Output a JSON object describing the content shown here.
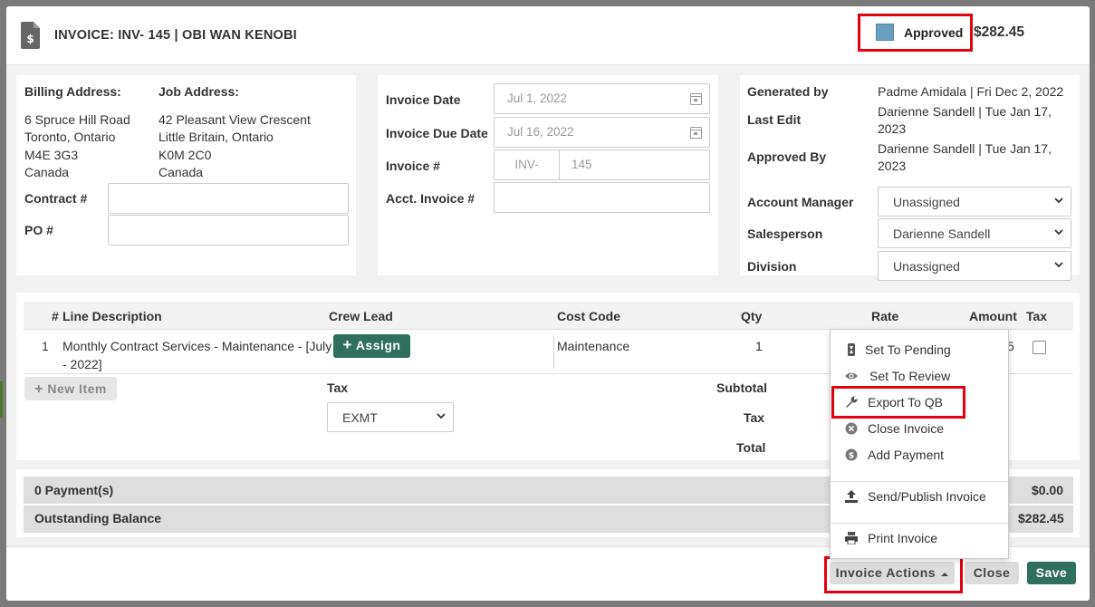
{
  "header": {
    "title": "INVOICE: INV- 145 | OBI WAN KENOBI",
    "status": "Approved",
    "status_color": "#6a9fbf",
    "total": "$282.45"
  },
  "billing": {
    "billing_label": "Billing Address:",
    "billing_lines": [
      "6 Spruce Hill Road",
      "Toronto, Ontario",
      "M4E 3G3",
      "Canada"
    ],
    "job_label": "Job Address:",
    "job_lines": [
      "42 Pleasant View Crescent",
      "Little Britain, Ontario",
      "K0M 2C0",
      "Canada"
    ],
    "contract_label": "Contract #",
    "contract_value": "",
    "po_label": "PO #",
    "po_value": ""
  },
  "dates": {
    "invoice_date_label": "Invoice Date",
    "invoice_date_value": "Jul 1, 2022",
    "due_date_label": "Invoice Due Date",
    "due_date_value": "Jul 16, 2022",
    "invoice_num_label": "Invoice #",
    "invoice_prefix": "INV-",
    "invoice_number": "145",
    "acct_invoice_label": "Acct. Invoice #",
    "acct_invoice_value": ""
  },
  "meta": {
    "generated_label": "Generated by",
    "generated_value": "Padme Amidala | Fri Dec 2, 2022",
    "last_edit_label": "Last Edit",
    "last_edit_line1": "Darienne Sandell | Tue Jan 17,",
    "last_edit_line2": "2023",
    "approved_label": "Approved By",
    "approved_line1": "Darienne Sandell | Tue Jan 17,",
    "approved_line2": "2023",
    "account_manager_label": "Account Manager",
    "account_manager_value": "Unassigned",
    "salesperson_label": "Salesperson",
    "salesperson_value": "Darienne Sandell",
    "division_label": "Division",
    "division_value": "Unassigned"
  },
  "line_items": {
    "headers": {
      "num": "#",
      "description": "Line Description",
      "crew": "Crew Lead",
      "cost_code": "Cost Code",
      "qty": "Qty",
      "rate": "Rate",
      "amount": "Amount",
      "tax": "Tax"
    },
    "rows": [
      {
        "num": "1",
        "description_line1": "Monthly Contract Services - Maintenance - [July",
        "description_line2": "- 2022]",
        "assign_label": "Assign",
        "cost_code": "Maintenance",
        "qty": "1",
        "amount_partial": "5"
      }
    ],
    "new_item_label": "New Item",
    "tax_label": "Tax",
    "tax_select": "EXMT",
    "subtotal_label": "Subtotal",
    "tax_total_label": "Tax",
    "total_label": "Total"
  },
  "payments": {
    "payments_label": "0 Payment(s)",
    "payments_value": "$0.00",
    "outstanding_label": "Outstanding Balance",
    "outstanding_value": "$282.45"
  },
  "dropdown": {
    "items": [
      {
        "label": "Set To Pending",
        "icon": "hourglass-icon"
      },
      {
        "label": "Set To Review",
        "icon": "eye-icon"
      },
      {
        "label": "Export To QB",
        "icon": "wrench-icon"
      },
      {
        "label": "Close Invoice",
        "icon": "close-circle-icon"
      },
      {
        "label": "Add Payment",
        "icon": "dollar-circle-icon"
      },
      {
        "label": "Send/Publish Invoice",
        "icon": "upload-icon"
      },
      {
        "label": "Print Invoice",
        "icon": "printer-icon"
      }
    ]
  },
  "footer": {
    "invoice_actions_label": "Invoice Actions",
    "close_label": "Close",
    "save_label": "Save",
    "primary_color": "#2f6f5e"
  }
}
